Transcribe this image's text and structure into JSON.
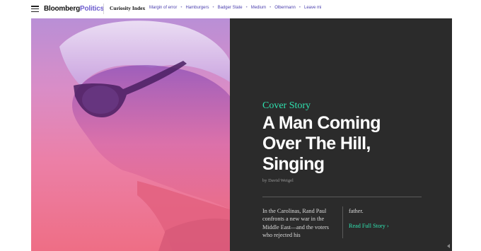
{
  "header": {
    "brand_main": "Bloomberg",
    "brand_section": "Politics",
    "curiosity_index": "Curiosity Index",
    "nav_items": [
      "Margin of error",
      "Hamburgers",
      "Badger State",
      "Medium",
      "Olbermann",
      "Leave mi"
    ],
    "separator": "•"
  },
  "story": {
    "label": "Cover Story",
    "headline_lines": [
      "A Man Coming",
      "Over The Hill,",
      "Singing"
    ],
    "byline": "by David Weigel",
    "deck_left": "In the Carolinas, Rand Paul confronts a new war in the Middle East—and the voters who rejected his",
    "deck_right": "father.",
    "read_more": "Read Full Story ›"
  },
  "colors": {
    "accent": "#2fe3b0",
    "nav_link": "#4b3fae",
    "panel_bg": "#2b2b2b",
    "hero_top": "#b98fd6",
    "hero_bottom": "#ee6e85"
  }
}
